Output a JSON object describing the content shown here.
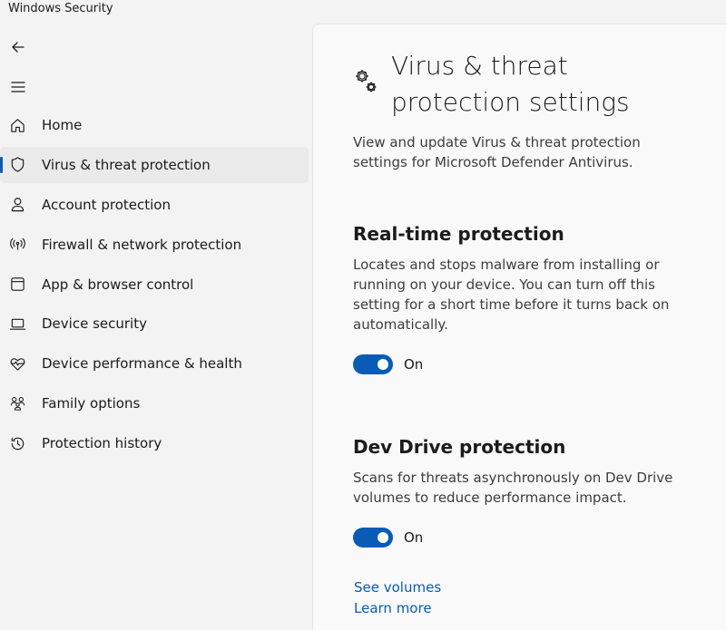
{
  "window": {
    "title": "Windows Security"
  },
  "sidebar": {
    "items": [
      {
        "label": "Home",
        "icon": "home-icon"
      },
      {
        "label": "Virus & threat protection",
        "icon": "shield-icon",
        "selected": true
      },
      {
        "label": "Account protection",
        "icon": "person-icon"
      },
      {
        "label": "Firewall & network protection",
        "icon": "wifi-antenna-icon"
      },
      {
        "label": "App & browser control",
        "icon": "app-window-icon"
      },
      {
        "label": "Device security",
        "icon": "laptop-icon"
      },
      {
        "label": "Device performance & health",
        "icon": "heart-pulse-icon"
      },
      {
        "label": "Family options",
        "icon": "family-icon"
      },
      {
        "label": "Protection history",
        "icon": "history-icon"
      }
    ]
  },
  "main": {
    "title": "Virus & threat protection settings",
    "description": "View and update Virus & threat protection settings for Microsoft Defender Antivirus.",
    "sections": [
      {
        "title": "Real-time protection",
        "description": "Locates and stops malware from installing or running on your device. You can turn off this setting for a short time before it turns back on automatically.",
        "toggle_label": "On",
        "toggle_on": true
      },
      {
        "title": "Dev Drive protection",
        "description": "Scans for threats asynchronously on Dev Drive volumes to reduce performance impact.",
        "toggle_label": "On",
        "toggle_on": true
      }
    ],
    "links": [
      "See volumes",
      "Learn more"
    ]
  },
  "colors": {
    "accent": "#0a5bb5",
    "sidebar_bg": "#f3f3f3",
    "content_bg": "#f9f9f9"
  }
}
